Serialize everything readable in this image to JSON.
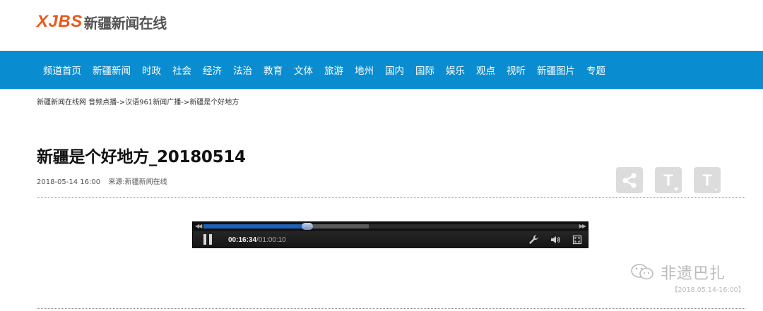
{
  "logo": {
    "mark": "XJBS",
    "text": "新疆新闻在线"
  },
  "nav": {
    "items": [
      "频道首页",
      "新疆新闻",
      "时政",
      "社会",
      "经济",
      "法治",
      "教育",
      "文体",
      "旅游",
      "地州",
      "国内",
      "国际",
      "娱乐",
      "观点",
      "视听",
      "新疆图片",
      "专题"
    ]
  },
  "breadcrumb": "新疆新闻在线网 音频点播->汉语961新闻广播->新疆是个好地方",
  "article": {
    "title": "新疆是个好地方_20180514",
    "date": "2018-05-14 16:00",
    "source": "来源:新疆新闻在线"
  },
  "tools": {
    "share_icon": "share-icon",
    "font_increase_label": "T",
    "font_increase_sub": "+",
    "font_decrease_label": "T",
    "font_decrease_sub": "-"
  },
  "player": {
    "current_time": "00:16:34",
    "total_time": "/01:00:10",
    "progress": 0.2754,
    "buffered": 0.44
  },
  "watermark": {
    "brand": "非遗巴扎",
    "date": "【2018.05.14-16:00】"
  },
  "colors": {
    "nav_bg": "#0a8dd0",
    "logo_accent": "#e85a1c",
    "progress_fill": "#1e62b6"
  }
}
